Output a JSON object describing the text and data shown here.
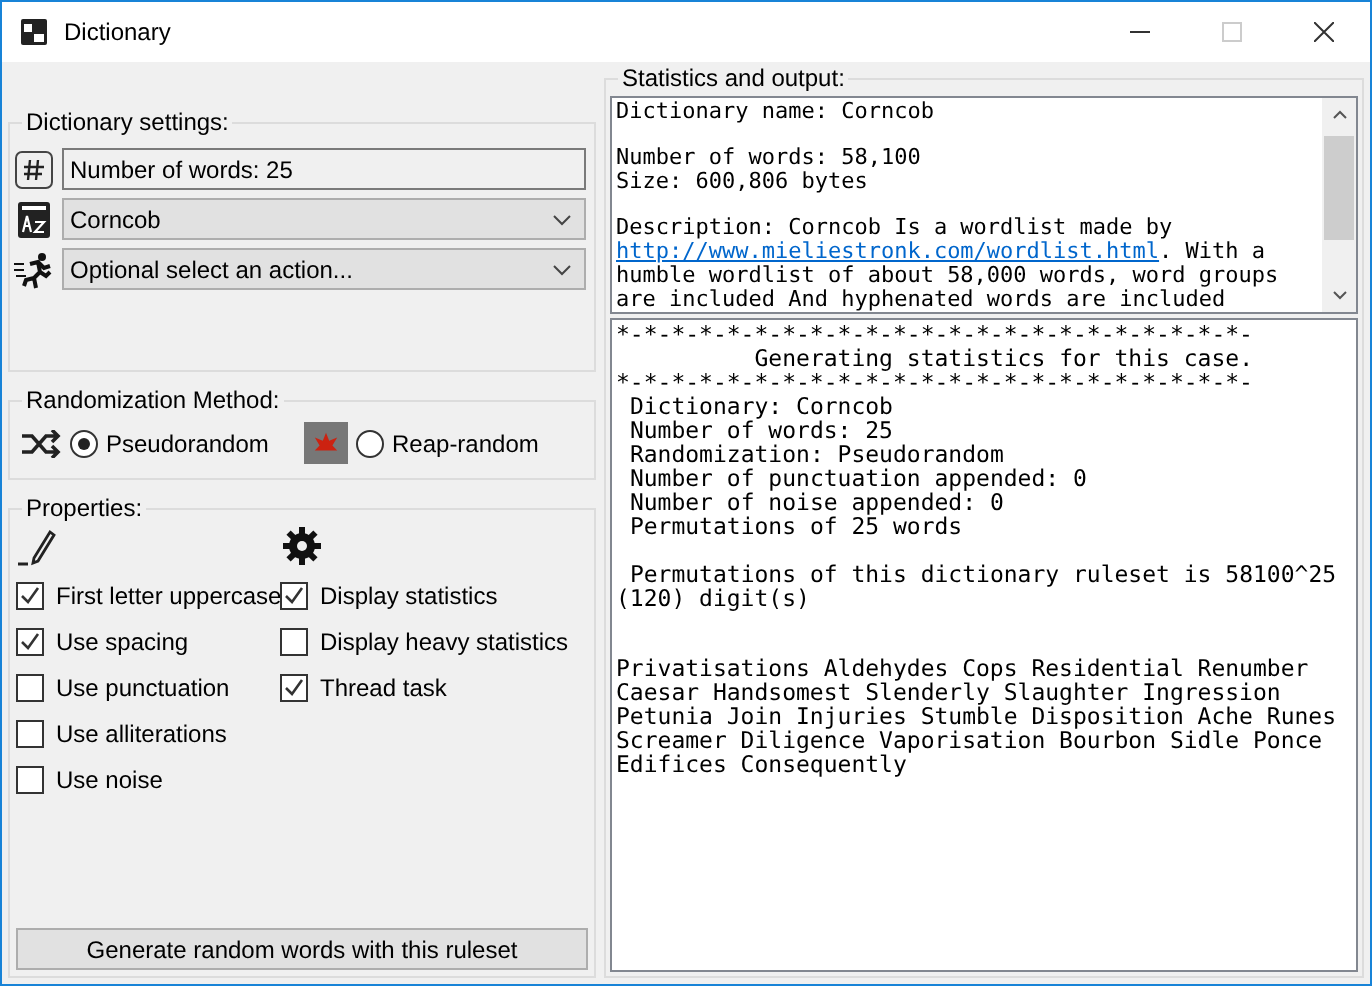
{
  "window": {
    "title": "Dictionary",
    "maximize_disabled": true
  },
  "dictionary_settings": {
    "title": "Dictionary settings:",
    "word_count_field": {
      "value": "Number of words: 25"
    },
    "dictionary_dropdown": {
      "value": "Corncob"
    },
    "action_dropdown": {
      "value": "Optional select an action..."
    }
  },
  "randomization": {
    "title": "Randomization Method:",
    "options": [
      {
        "label": "Pseudorandom",
        "selected": true
      },
      {
        "label": "Reap-random",
        "selected": false
      }
    ]
  },
  "properties": {
    "title": "Properties:",
    "text_options": [
      {
        "label": "First letter uppercase",
        "checked": true
      },
      {
        "label": "Use spacing",
        "checked": true
      },
      {
        "label": "Use punctuation",
        "checked": false
      },
      {
        "label": "Use alliterations",
        "checked": false
      },
      {
        "label": "Use noise",
        "checked": false
      }
    ],
    "program_options": [
      {
        "label": "Display statistics",
        "checked": true
      },
      {
        "label": "Display heavy statistics",
        "checked": false
      },
      {
        "label": "Thread task",
        "checked": true
      }
    ]
  },
  "generate_button": "Generate random words with this ruleset",
  "output": {
    "title": "Statistics and output:",
    "info_blocks": [
      [
        "Dictionary name: Corncob"
      ],
      [
        "Number of words: 58,100",
        "Size: 600,806 bytes"
      ]
    ],
    "description": {
      "prefix": "Description: Corncob Is a wordlist made by ",
      "link": "http://www.mieliestronk.com/wordlist.html",
      "suffix": ". With a humble wordlist of about 58,000 words, word groups are included And hyphenated words are included"
    },
    "stats_blocks": [
      [
        "*-*-*-*-*-*-*-*-*-*-*-*-*-*-*-*-*-*-*-*-*-*-*-",
        "          Generating statistics for this case.",
        "*-*-*-*-*-*-*-*-*-*-*-*-*-*-*-*-*-*-*-*-*-*-*-",
        " Dictionary: Corncob",
        " Number of words: 25",
        " Randomization: Pseudorandom",
        " Number of punctuation appended: 0",
        " Number of noise appended: 0",
        " Permutations of 25 words"
      ],
      [
        " Permutations of this dictionary ruleset is 58100^25 (120) digit(s)"
      ]
    ],
    "words": "Privatisations Aldehydes Cops Residential Renumber Caesar Handsomest Slenderly Slaughter Ingression Petunia Join Injuries Stumble Disposition Ache Runes Screamer Diligence Vaporisation Bourbon Sidle Ponce Edifices Consequently"
  }
}
